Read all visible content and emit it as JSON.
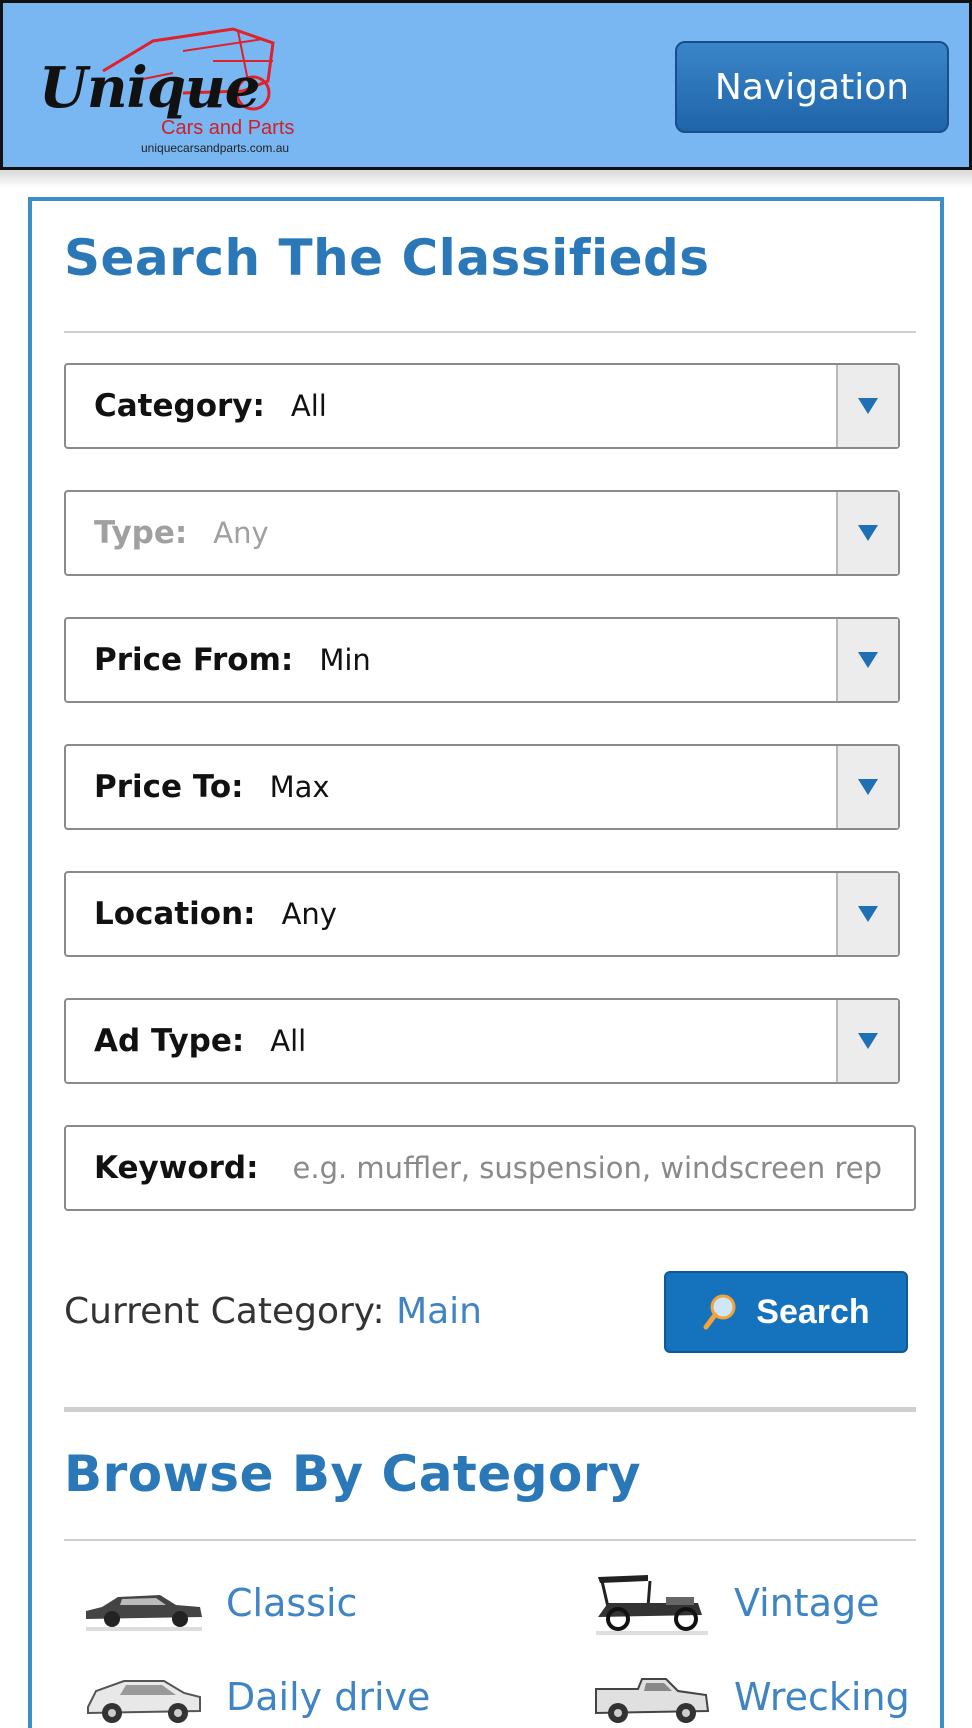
{
  "header": {
    "logo": {
      "word": "Unique",
      "subtitle": "Cars and Parts",
      "url": "uniquecarsandparts.com.au"
    },
    "nav_button": "Navigation"
  },
  "search": {
    "title": "Search The Classifieds",
    "fields": [
      {
        "label": "Category:",
        "value": "All",
        "enabled": true
      },
      {
        "label": "Type:",
        "value": "Any",
        "enabled": false
      },
      {
        "label": "Price From:",
        "value": "Min",
        "enabled": true
      },
      {
        "label": "Price To:",
        "value": "Max",
        "enabled": true
      },
      {
        "label": "Location:",
        "value": "Any",
        "enabled": true
      },
      {
        "label": "Ad Type:",
        "value": "All",
        "enabled": true
      }
    ],
    "keyword": {
      "label": "Keyword:",
      "placeholder": "e.g. muffler, suspension, windscreen rep"
    },
    "current_category_label": "Current Category:",
    "current_category_value": "Main",
    "search_button": "Search"
  },
  "browse": {
    "title": "Browse By Category",
    "categories": [
      {
        "name": "Classic",
        "icon": "classic-car-icon"
      },
      {
        "name": "Vintage",
        "icon": "vintage-car-icon"
      },
      {
        "name": "Daily drive",
        "icon": "suv-car-icon"
      },
      {
        "name": "Wrecking",
        "icon": "ute-car-icon"
      }
    ]
  },
  "colors": {
    "header_bg": "#79b7f2",
    "accent": "#2a78b8",
    "link": "#3f84c4",
    "button": "#1573bd"
  }
}
